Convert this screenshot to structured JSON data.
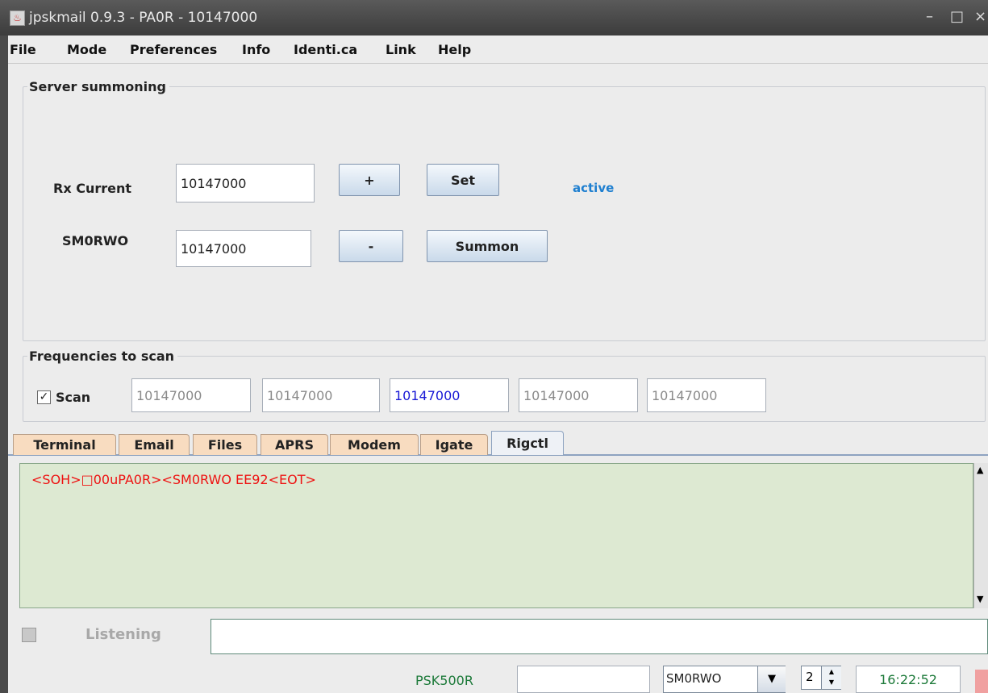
{
  "window": {
    "title": "jpskmail 0.9.3 - PA0R - 10147000"
  },
  "menu": [
    "File",
    "Mode",
    "Preferences",
    "Info",
    "Identi.ca",
    "Link",
    "Help"
  ],
  "server": {
    "legend": "Server summoning",
    "rx_label": "Rx Current",
    "rx_value": "10147000",
    "server_label": "SM0RWO",
    "server_value": "10147000",
    "plus_label": "+",
    "minus_label": "-",
    "set_label": "Set",
    "summon_label": "Summon",
    "status": "active"
  },
  "scan": {
    "legend": "Frequencies to scan",
    "scan_label": "Scan",
    "scan_checked": true,
    "freqs": [
      "10147000",
      "10147000",
      "10147000",
      "10147000",
      "10147000"
    ]
  },
  "tabs": [
    "Terminal",
    "Email",
    "Files",
    "APRS",
    "Modem",
    "Igate",
    "Rigctl"
  ],
  "active_tab": "Rigctl",
  "console": {
    "text": "<SOH>□00uPA0R><SM0RWO EE92<EOT>"
  },
  "status": {
    "listening": "Listening",
    "mode": "PSK500R",
    "server_select": "SM0RWO",
    "spinner": "2",
    "time": "16:22:52"
  },
  "colors": {
    "accent": "#1e7fd0",
    "console_bg": "#dde9d2",
    "console_text": "#ee1111",
    "tab_bg": "#f8dcc0"
  }
}
